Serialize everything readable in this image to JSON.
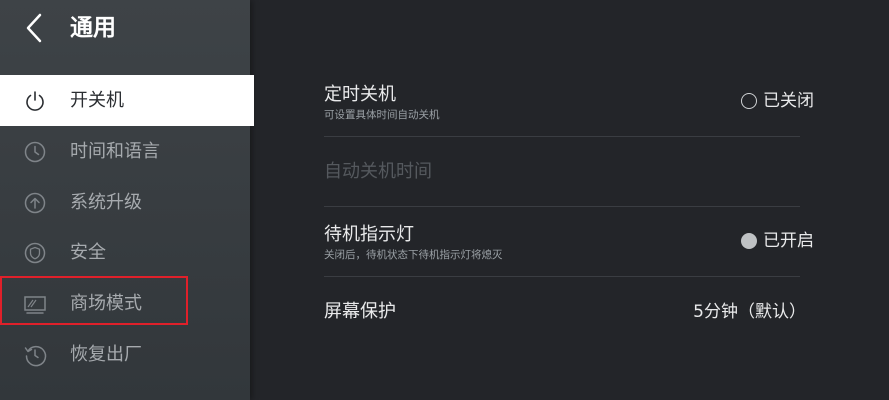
{
  "header": {
    "title": "通用"
  },
  "sidebar": {
    "items": [
      {
        "label": "开关机",
        "icon": "power-icon",
        "active": true
      },
      {
        "label": "时间和语言",
        "icon": "clock-icon",
        "active": false
      },
      {
        "label": "系统升级",
        "icon": "upgrade-icon",
        "active": false
      },
      {
        "label": "安全",
        "icon": "shield-icon",
        "active": false
      },
      {
        "label": "商场模式",
        "icon": "monitor-icon",
        "active": false
      },
      {
        "label": "恢复出厂",
        "icon": "restore-icon",
        "active": false
      }
    ]
  },
  "main": {
    "timer_shutdown": {
      "title": "定时关机",
      "subtitle": "可设置具体时间自动关机",
      "status": "已关闭",
      "enabled": false
    },
    "shutdown_time": {
      "title": "自动关机时间"
    },
    "standby_light": {
      "title": "待机指示灯",
      "subtitle": "关闭后，待机状态下待机指示灯将熄灭",
      "status": "已开启",
      "enabled": true
    },
    "screensaver": {
      "title": "屏幕保护",
      "value": "5分钟（默认）"
    }
  },
  "colors": {
    "highlight_box": "#e0202a",
    "active_item_bg": "#ffffff",
    "background": "#232529"
  }
}
